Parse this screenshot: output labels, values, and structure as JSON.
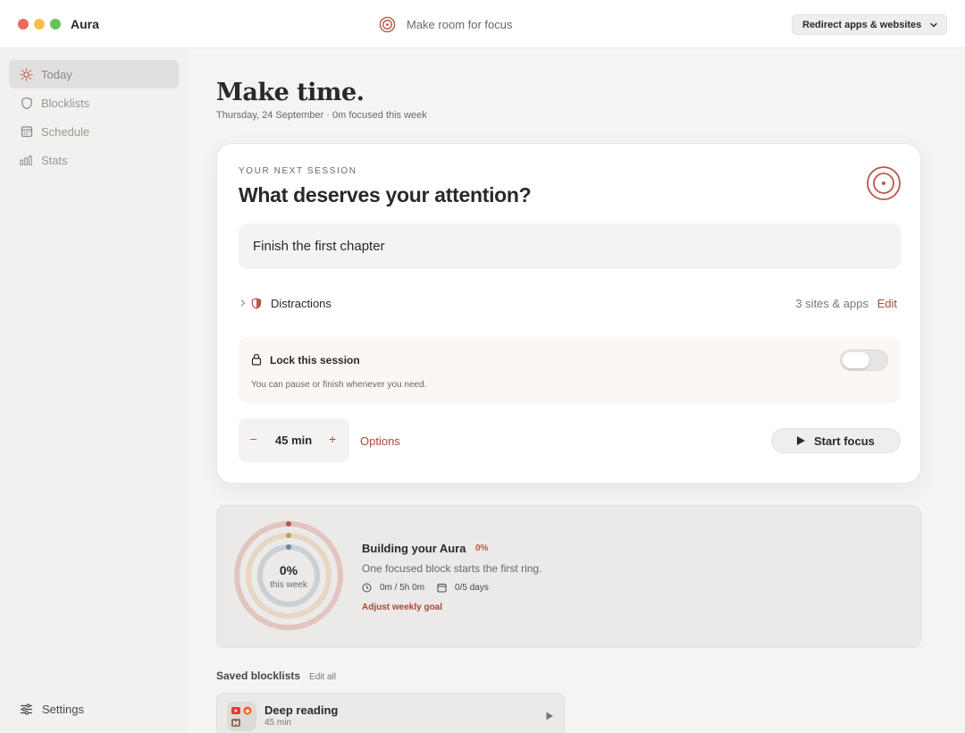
{
  "window": {
    "app_name": "Aura",
    "center_title": "Make room for focus",
    "redirect_label": "Redirect apps & websites"
  },
  "sidebar": {
    "items": [
      {
        "label": "Today",
        "icon": "sun-icon",
        "active": true
      },
      {
        "label": "Blocklists",
        "icon": "shield-icon",
        "active": false
      },
      {
        "label": "Schedule",
        "icon": "calendar-icon",
        "active": false
      },
      {
        "label": "Stats",
        "icon": "bar-chart-icon",
        "active": false
      }
    ],
    "settings_label": "Settings"
  },
  "main": {
    "headline": "Make time.",
    "subline": "Thursday, 24 September · 0m focused this week"
  },
  "session": {
    "eyebrow": "YOUR NEXT SESSION",
    "title": "What deserves your attention?",
    "task_value": "Finish the first chapter",
    "distractions_label": "Distractions",
    "distractions_count": "3 sites & apps",
    "edit_label": "Edit",
    "lock_title": "Lock this session",
    "lock_subtitle": "You can pause or finish whenever you need.",
    "lock_enabled": false,
    "minus": "–",
    "duration": "45 min",
    "plus": "+",
    "options_label": "Options",
    "start_label": "Start focus"
  },
  "aura": {
    "ring_percent": "0%",
    "ring_sub": "this week",
    "title": "Building your Aura",
    "title_pct": "0%",
    "subtitle": "One focused block starts the first ring.",
    "time_meta": "0m / 5h 0m",
    "days_meta": "0/5 days",
    "adjust_link": "Adjust weekly goal",
    "progress_fraction": 0
  },
  "saved": {
    "heading": "Saved blocklists",
    "edit_all": "Edit all",
    "items": [
      {
        "title": "Deep reading",
        "sub": "45 min",
        "icon_letter": "M"
      }
    ]
  },
  "colors": {
    "accent": "#a8483a",
    "ring_outer": "#e3c4be",
    "ring_middle": "#e8d6c2",
    "ring_inner": "#c9d1d6"
  }
}
